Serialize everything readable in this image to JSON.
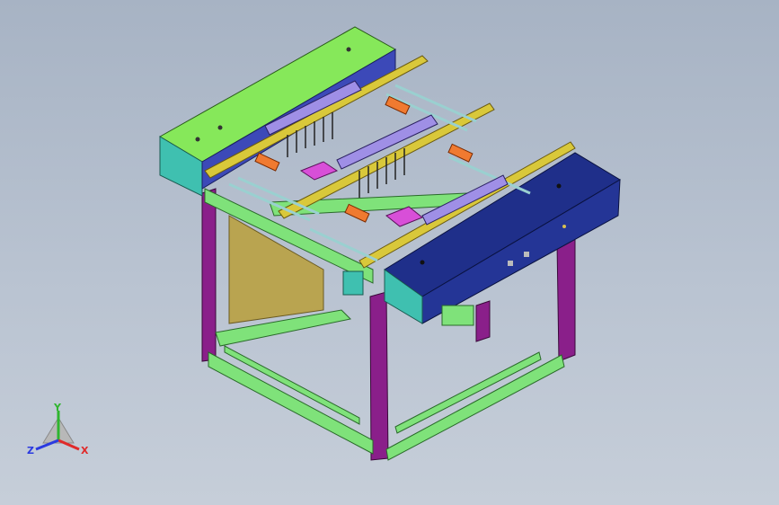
{
  "viewport": {
    "background_top": "#a7b3c4",
    "background_bottom": "#c6ced9"
  },
  "model": {
    "colors": {
      "frame_purple": "#8a1f8a",
      "frame_green": "#7fe27a",
      "housing_left_top": "#86e85a",
      "housing_left_front": "#3fc0b0",
      "housing_right": "#1f2f8a",
      "panel_tan": "#b9a450",
      "rail_yellow": "#d9c83a",
      "actuator_orange": "#f07a30",
      "actuator_pink": "#d84fd8",
      "plate_lavender": "#9f8fe6"
    }
  },
  "triad": {
    "y_label": "Y",
    "x_label": "X",
    "z_label": "Z",
    "y_color": "#2fb52f",
    "x_color": "#e02a2a",
    "z_color": "#2a3ae0"
  }
}
